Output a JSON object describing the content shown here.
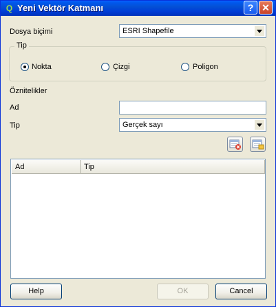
{
  "window": {
    "title": "Yeni Vektör Katmanı",
    "help_glyph": "?",
    "close_glyph": "✕",
    "app_glyph": "Q"
  },
  "form": {
    "format_label": "Dosya biçimi",
    "format_value": "ESRI Shapefile",
    "type_group_title": "Tip",
    "type_options": [
      {
        "label": "Nokta",
        "checked": true
      },
      {
        "label": "Çizgi",
        "checked": false
      },
      {
        "label": "Poligon",
        "checked": false
      }
    ],
    "attributes_heading": "Öznitelikler",
    "name_label": "Ad",
    "name_value": "",
    "type_label": "Tip",
    "type_value": "Gerçek sayı"
  },
  "attribute_table": {
    "columns": [
      "Ad",
      "Tip"
    ],
    "rows": []
  },
  "buttons": {
    "help": "Help",
    "ok": "OK",
    "cancel": "Cancel"
  },
  "colors": {
    "titlebar": "#0058ee",
    "dialog_bg": "#ece9d8",
    "close_button": "#c9452a"
  }
}
